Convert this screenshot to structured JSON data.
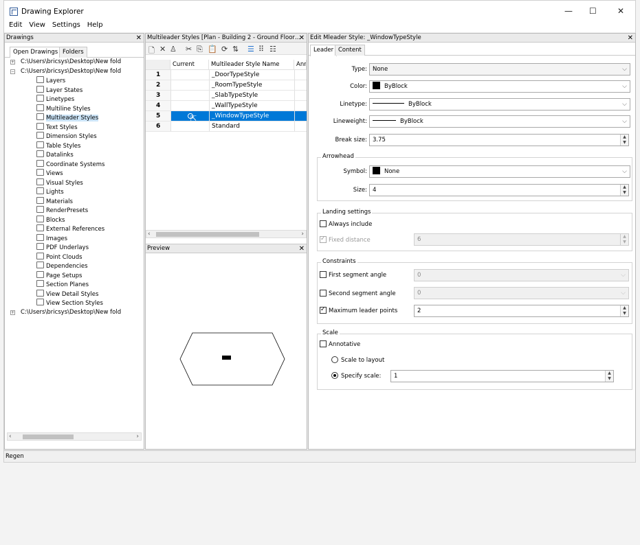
{
  "window": {
    "title": "Drawing Explorer",
    "controls": {
      "minimize": "—",
      "maximize": "☐",
      "close": "✕"
    }
  },
  "menu": [
    "Edit",
    "View",
    "Settings",
    "Help"
  ],
  "drawings_panel": {
    "title": "Drawings",
    "tabs": [
      "Open Drawings",
      "Folders"
    ],
    "tree": [
      {
        "label": "C:\\Users\\bricsys\\Desktop\\New fold",
        "level": 0,
        "expander": "+"
      },
      {
        "label": "C:\\Users\\bricsys\\Desktop\\New fold",
        "level": 0,
        "expander": "−"
      },
      {
        "label": "Layers",
        "level": 1
      },
      {
        "label": "Layer States",
        "level": 1
      },
      {
        "label": "Linetypes",
        "level": 1
      },
      {
        "label": "Multiline Styles",
        "level": 1
      },
      {
        "label": "Multileader Styles",
        "level": 1,
        "selected": true
      },
      {
        "label": "Text Styles",
        "level": 1
      },
      {
        "label": "Dimension Styles",
        "level": 1
      },
      {
        "label": "Table Styles",
        "level": 1
      },
      {
        "label": "Datalinks",
        "level": 1
      },
      {
        "label": "Coordinate Systems",
        "level": 1
      },
      {
        "label": "Views",
        "level": 1
      },
      {
        "label": "Visual Styles",
        "level": 1
      },
      {
        "label": "Lights",
        "level": 1
      },
      {
        "label": "Materials",
        "level": 1
      },
      {
        "label": "RenderPresets",
        "level": 1
      },
      {
        "label": "Blocks",
        "level": 1
      },
      {
        "label": "External References",
        "level": 1
      },
      {
        "label": "Images",
        "level": 1
      },
      {
        "label": "PDF Underlays",
        "level": 1
      },
      {
        "label": "Point Clouds",
        "level": 1
      },
      {
        "label": "Dependencies",
        "level": 1
      },
      {
        "label": "Page Setups",
        "level": 1
      },
      {
        "label": "Section Planes",
        "level": 1
      },
      {
        "label": "View Detail Styles",
        "level": 1
      },
      {
        "label": "View Section Styles",
        "level": 1
      },
      {
        "label": "C:\\Users\\bricsys\\Desktop\\New fold",
        "level": 0,
        "expander": "+"
      }
    ]
  },
  "styles_panel": {
    "title": "Multileader Styles [Plan - Building 2 - Ground Floor…",
    "columns": [
      "Current",
      "Multileader Style Name",
      "Ann"
    ],
    "rows": [
      {
        "num": "1",
        "name": "_DoorTypeStyle"
      },
      {
        "num": "2",
        "name": "_RoomTypeStyle"
      },
      {
        "num": "3",
        "name": "_SlabTypeStyle"
      },
      {
        "num": "4",
        "name": "_WallTypeStyle"
      },
      {
        "num": "5",
        "name": "_WindowTypeStyle",
        "selected": true
      },
      {
        "num": "6",
        "name": "Standard"
      }
    ],
    "preview_title": "Preview"
  },
  "edit_panel": {
    "title": "Edit Mleader Style: _WindowTypeStyle",
    "tabs": [
      "Leader",
      "Content"
    ],
    "type": {
      "label": "Type:",
      "value": "None"
    },
    "color": {
      "label": "Color:",
      "value": "ByBlock"
    },
    "linetype": {
      "label": "Linetype:",
      "value": "ByBlock"
    },
    "lineweight": {
      "label": "Lineweight:",
      "value": "ByBlock"
    },
    "break_size": {
      "label": "Break size:",
      "value": "3.75"
    },
    "arrowhead": {
      "title": "Arrowhead",
      "symbol": {
        "label": "Symbol:",
        "value": "None"
      },
      "size": {
        "label": "Size:",
        "value": "4"
      }
    },
    "landing": {
      "title": "Landing settings",
      "always_include": "Always include",
      "fixed_distance": "Fixed distance",
      "fixed_distance_value": "6"
    },
    "constraints": {
      "title": "Constraints",
      "first_segment": "First segment angle",
      "first_value": "0",
      "second_segment": "Second segment angle",
      "second_value": "0",
      "max_points": "Maximum leader points",
      "max_value": "2"
    },
    "scale": {
      "title": "Scale",
      "annotative": "Annotative",
      "scale_to_layout": "Scale to layout",
      "specify_scale": "Specify scale:",
      "specify_value": "1"
    }
  },
  "status": "Regen",
  "colors": {
    "selection": "#0078d7",
    "tree_selection": "#cce4f7"
  }
}
